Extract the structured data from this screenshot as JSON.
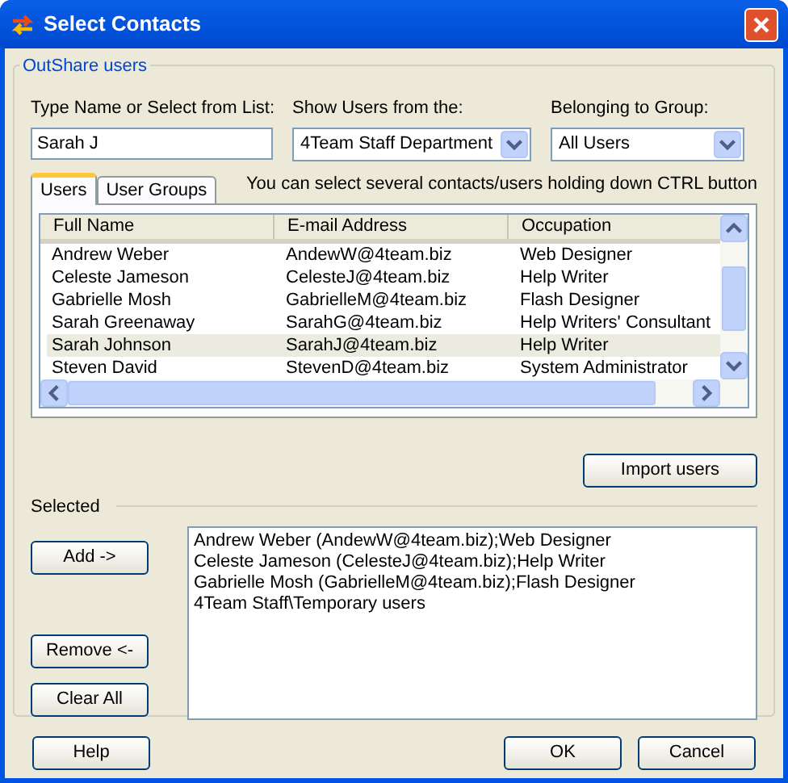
{
  "window": {
    "title": "Select Contacts"
  },
  "group": {
    "title": "OutShare users"
  },
  "name_field": {
    "label": "Type Name or Select from List:",
    "value": "Sarah J"
  },
  "show_users": {
    "label": "Show Users from the:",
    "value": "4Team Staff Department"
  },
  "group_filter": {
    "label": "Belonging to Group:",
    "value": "All Users"
  },
  "tabs": [
    {
      "label": "Users",
      "selected": true
    },
    {
      "label": "User Groups",
      "selected": false
    }
  ],
  "hint": "You can select several contacts/users holding down CTRL button",
  "table": {
    "columns": [
      "Full Name",
      "E-mail Address",
      "Occupation"
    ],
    "rows": [
      {
        "cells": [
          "Andrew Weber",
          "AndewW@4team.biz",
          "Web Designer"
        ],
        "selected": false
      },
      {
        "cells": [
          "Celeste Jameson",
          "CelesteJ@4team.biz",
          "Help Writer"
        ],
        "selected": false
      },
      {
        "cells": [
          "Gabrielle Mosh",
          "GabrielleM@4team.biz",
          "Flash Designer"
        ],
        "selected": false
      },
      {
        "cells": [
          "Sarah Greenaway",
          "SarahG@4team.biz",
          "Help Writers' Consultant"
        ],
        "selected": false
      },
      {
        "cells": [
          "Sarah Johnson",
          "SarahJ@4team.biz",
          "Help Writer"
        ],
        "selected": true
      },
      {
        "cells": [
          "Steven David",
          "StevenD@4team.biz",
          "System Administrator"
        ],
        "selected": false
      }
    ]
  },
  "import_button": "Import users",
  "selected_section": {
    "title": "Selected",
    "add_button": "Add ->",
    "remove_button": "Remove <-",
    "clear_button": "Clear All",
    "items": [
      "Andrew Weber (AndewW@4team.biz);Web Designer",
      "Celeste Jameson (CelesteJ@4team.biz);Help Writer",
      "Gabrielle Mosh (GabrielleM@4team.biz);Flash Designer",
      "4Team Staff\\Temporary users"
    ]
  },
  "buttons": {
    "help": "Help",
    "ok": "OK",
    "cancel": "Cancel"
  }
}
